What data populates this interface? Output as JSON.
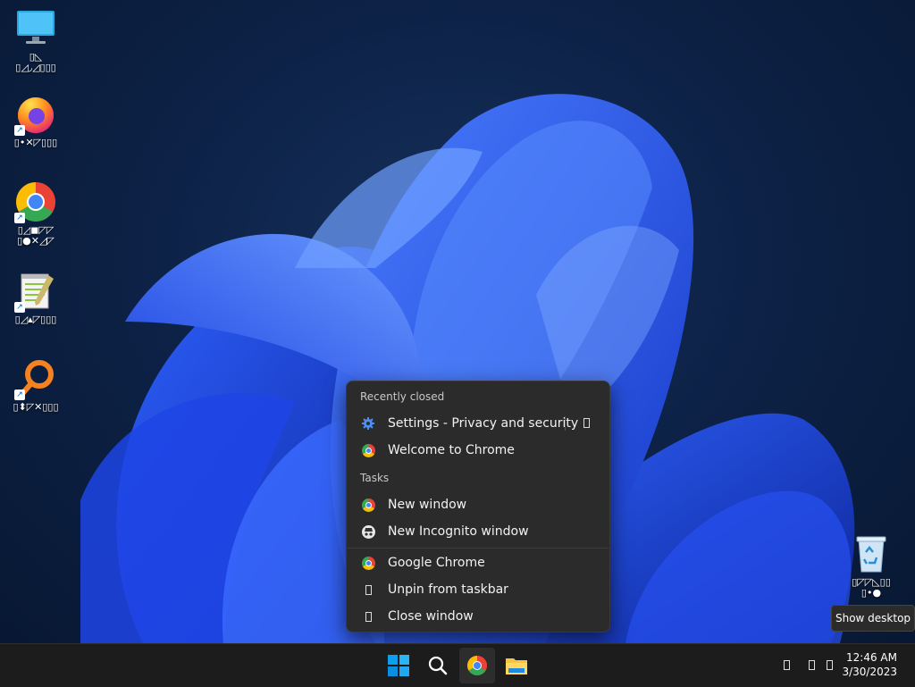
{
  "desktop": {
    "icons": [
      {
        "label": "▯◺\n▯◿◞◿▯▯▯"
      },
      {
        "label": "▯•✕◸▯▯▯"
      },
      {
        "label": "▯◿◼◸◸\n▯●✕◿◸"
      },
      {
        "label": "▯◿▴◸▯▯▯"
      },
      {
        "label": "▯⬍◸✕▯▯▯"
      },
      {
        "label": "▯◸◸◺▯▯\n▯•●"
      }
    ]
  },
  "jumplist": {
    "recently_closed_header": "Recently closed",
    "recent": [
      {
        "label": "Settings - Privacy and security",
        "icon": "gear-icon"
      },
      {
        "label": "Welcome to Chrome",
        "icon": "chrome-icon"
      }
    ],
    "tasks_header": "Tasks",
    "tasks": [
      {
        "label": "New window",
        "icon": "chrome-icon"
      },
      {
        "label": "New Incognito window",
        "icon": "incognito-icon"
      }
    ],
    "app": [
      {
        "label": "Google Chrome",
        "icon": "chrome-icon"
      },
      {
        "label": "Unpin from taskbar",
        "icon": "unpin-icon"
      },
      {
        "label": "Close window",
        "icon": "close-window-icon"
      }
    ]
  },
  "tooltip": {
    "text": "Show desktop"
  },
  "taskbar": {
    "clock": {
      "time": "12:46 AM",
      "date": "3/30/2023"
    }
  },
  "colors": {
    "accent": "#0078d4",
    "menu_bg": "#2b2b2b",
    "taskbar_bg": "#1c1c1c"
  }
}
